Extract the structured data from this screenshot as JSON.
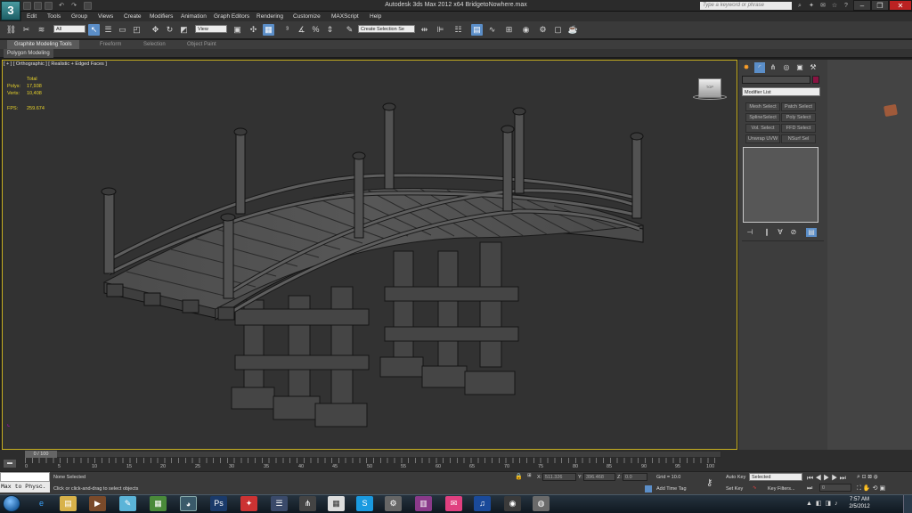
{
  "window": {
    "title": "Autodesk 3ds Max  2012 x64     BridgetoNowhere.max",
    "search_placeholder": "Type a keyword or phrase",
    "logo": "3"
  },
  "menu": [
    "Edit",
    "Tools",
    "Group",
    "Views",
    "Create",
    "Modifiers",
    "Animation",
    "Graph Editors",
    "Rendering",
    "Customize",
    "MAXScript",
    "Help"
  ],
  "toolbar": {
    "selection_filter": "All",
    "reference_coord": "View",
    "named_selection": "Create Selection Se"
  },
  "ribbon": {
    "tabs": [
      "Graphite Modeling Tools",
      "Freeform",
      "Selection",
      "Object Paint"
    ],
    "panel": "Polygon Modeling"
  },
  "viewport": {
    "label": "[ + ] [ Orthographic ] [ Realistic + Edged Faces ]",
    "stats_header": "Total",
    "polys_label": "Polys:",
    "polys_value": "17,938",
    "verts_label": "Verts:",
    "verts_value": "10,408",
    "fps_label": "FPS:",
    "fps_value": "259.674",
    "viewcube_label": "TOP"
  },
  "command_panel": {
    "modifier_list": "Modifier List",
    "buttons": [
      "Mesh Select",
      "Patch Select",
      "SplineSelect",
      "Poly Select",
      "Vol. Select",
      "FFD Select",
      "Unwrap UVW",
      "NSurf Sel"
    ]
  },
  "timeline": {
    "frame_display": "0 / 100",
    "ticks": [
      "0",
      "5",
      "10",
      "15",
      "20",
      "25",
      "30",
      "35",
      "40",
      "45",
      "50",
      "55",
      "60",
      "65",
      "70",
      "75",
      "80",
      "85",
      "90",
      "95",
      "100"
    ]
  },
  "status": {
    "listener": "Max to Physc.",
    "selection": "None Selected",
    "prompt": "Click or click-and-drag to select objects",
    "x_label": "X:",
    "x_value": "511.326",
    "y_label": "Y:",
    "y_value": "396.468",
    "z_label": "Z:",
    "z_value": "0.0",
    "grid": "Grid = 10.0",
    "add_time_tag": "Add Time Tag",
    "auto_key": "Auto Key",
    "auto_key_mode": "Selected",
    "set_key": "Set Key",
    "key_filters": "Key Filters...",
    "current_frame": "0"
  },
  "taskbar": {
    "time": "7:57 AM",
    "date": "2/5/2012"
  },
  "colors": {
    "viewport_border": "#c8b020",
    "stats": "#e8d22a",
    "object_color": "#8a1342"
  }
}
